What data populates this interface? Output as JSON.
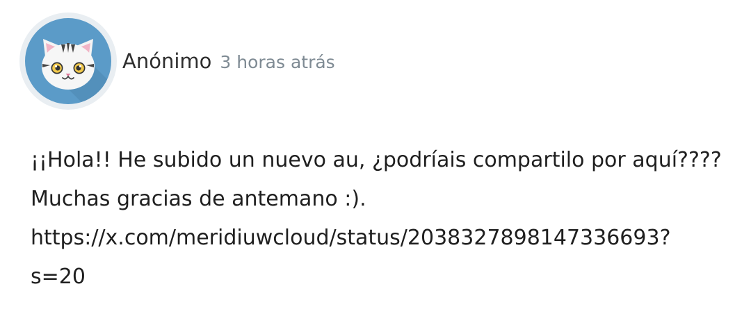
{
  "comment": {
    "author": "Anónimo",
    "timestamp": "3 horas atrás",
    "avatar_icon": "cat-avatar-icon",
    "avatar_bg": "#5b9bc8",
    "body_lines": [
      "¡¡Hola!! He subido un nuevo au, ¿podríais compartilo por aquí????",
      "Muchas gracias de antemano :).",
      "https://x.com/meridiuwcloud/status/2038327898147336693?",
      "s=20"
    ]
  },
  "colors": {
    "author": "#2e2e2e",
    "timestamp": "#7e8a93",
    "text": "#1f1f1f"
  }
}
